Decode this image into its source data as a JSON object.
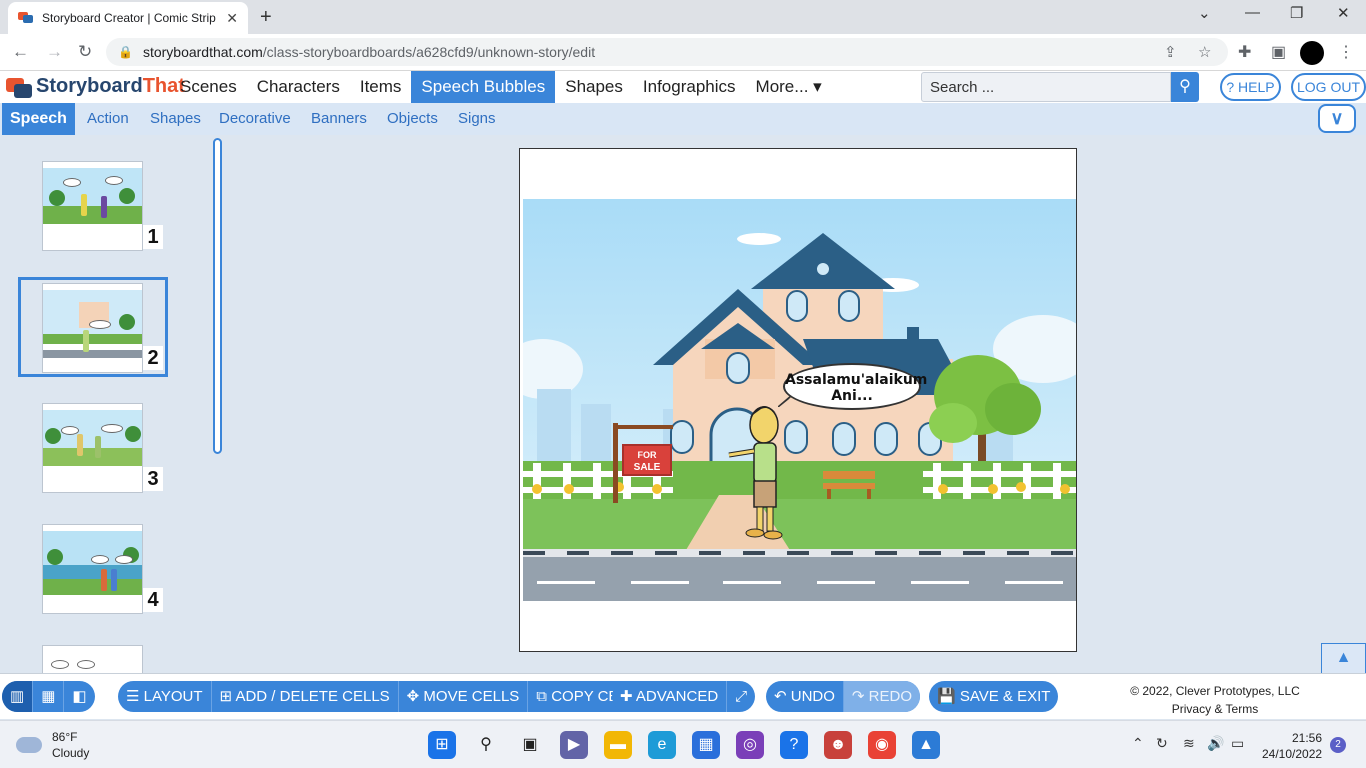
{
  "browser": {
    "tab_title": "Storyboard Creator | Comic Strip",
    "url_domain": "storyboardthat.com",
    "url_path": "/class-storyboardboards/a628cfd9/unknown-story/edit"
  },
  "app": {
    "logo_part1": "Storyboard",
    "logo_part2": "That",
    "menu": [
      "Scenes",
      "Characters",
      "Items",
      "Speech Bubbles",
      "Shapes",
      "Infographics",
      "More... ▾"
    ],
    "active_menu": "Speech Bubbles",
    "search_placeholder": "Search ...",
    "help_label": "? HELP",
    "logout_label": "LOG OUT",
    "subtabs": [
      "Speech",
      "Action",
      "Shapes",
      "Decorative",
      "Banners",
      "Objects",
      "Signs"
    ],
    "active_subtab": "Speech"
  },
  "sidebar": {
    "cells": [
      {
        "number": "1"
      },
      {
        "number": "2",
        "selected": true
      },
      {
        "number": "3"
      },
      {
        "number": "4"
      }
    ]
  },
  "canvas": {
    "speech_line1": "Assalamu'alaikum",
    "speech_line2": "Ani...",
    "sign_line1": "FOR",
    "sign_line2": "SALE"
  },
  "toolbar": {
    "layout": "LAYOUT",
    "add_delete": "ADD / DELETE CELLS",
    "move": "MOVE CELLS",
    "copy": "COPY CELLS",
    "advanced": "ADVANCED",
    "undo": "UNDO",
    "redo": "REDO",
    "save_exit": "SAVE & EXIT",
    "copyright": "© 2022, Clever Prototypes, LLC",
    "privacy": "Privacy & Terms"
  },
  "taskbar": {
    "temperature": "86°F",
    "condition": "Cloudy",
    "time": "21:56",
    "date": "24/10/2022",
    "notifications": "2"
  },
  "colors": {
    "accent": "#3a85d9",
    "brand_orange": "#e8542f",
    "brand_navy": "#27466e"
  }
}
